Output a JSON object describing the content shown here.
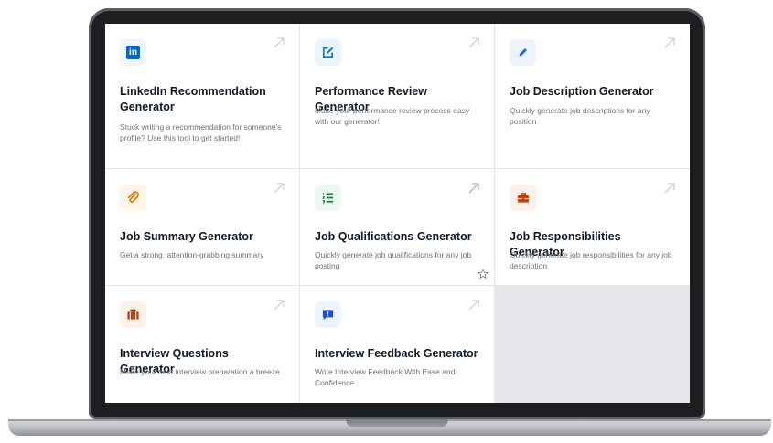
{
  "cards": [
    {
      "title": "LinkedIn Recommendation Generator",
      "description": "Stuck writing a recommendation for someone's profile? Use this tool to get started!",
      "icon": "linkedin-icon",
      "icon_color": "#0a66c2",
      "icon_bg": "#eef5fc",
      "icon_glyph": "in"
    },
    {
      "title": "Performance Review Generator",
      "description": "Make your performance review process easy with our generator!",
      "icon": "edit-icon",
      "icon_color": "#0e7ab8",
      "icon_bg": "#eaf5fb"
    },
    {
      "title": "Job Description Generator",
      "description": "Quickly generate job descriptions for any position",
      "icon": "pencil-icon",
      "icon_color": "#2563eb",
      "icon_bg": "#eef3fe"
    },
    {
      "title": "Job Summary Generator",
      "description": "Get a strong, attention-grabbing summary",
      "icon": "paperclip-icon",
      "icon_color": "#d97706",
      "icon_bg": "#fdf6e8"
    },
    {
      "title": "Job Qualifications Generator",
      "description": "Quickly generate job qualifications for any job posting",
      "icon": "list-icon",
      "icon_color": "#15803d",
      "icon_bg": "#ecf8f0"
    },
    {
      "title": "Job Responsibilities Generator",
      "description": "Quickly generate job responsibilities for any job description",
      "icon": "toolbox-icon",
      "icon_color": "#c2410c",
      "icon_bg": "#fdf1ea"
    },
    {
      "title": "Interview Questions Generator",
      "description": "Make your next interview preparation a breeze",
      "icon": "briefcase-icon",
      "icon_color": "#c2410c",
      "icon_bg": "#fdf1ea"
    },
    {
      "title": "Interview Feedback Generator",
      "description": "Write Interview Feedback With Ease and Confidence",
      "icon": "feedback-icon",
      "icon_color": "#1d4ed8",
      "icon_bg": "#eef3fe"
    }
  ],
  "colors": {
    "card_bg": "#ffffff",
    "empty_bg": "#e4e6e9",
    "title": "#111827",
    "desc": "#6b7280",
    "arrow": "#c4c7cc"
  }
}
